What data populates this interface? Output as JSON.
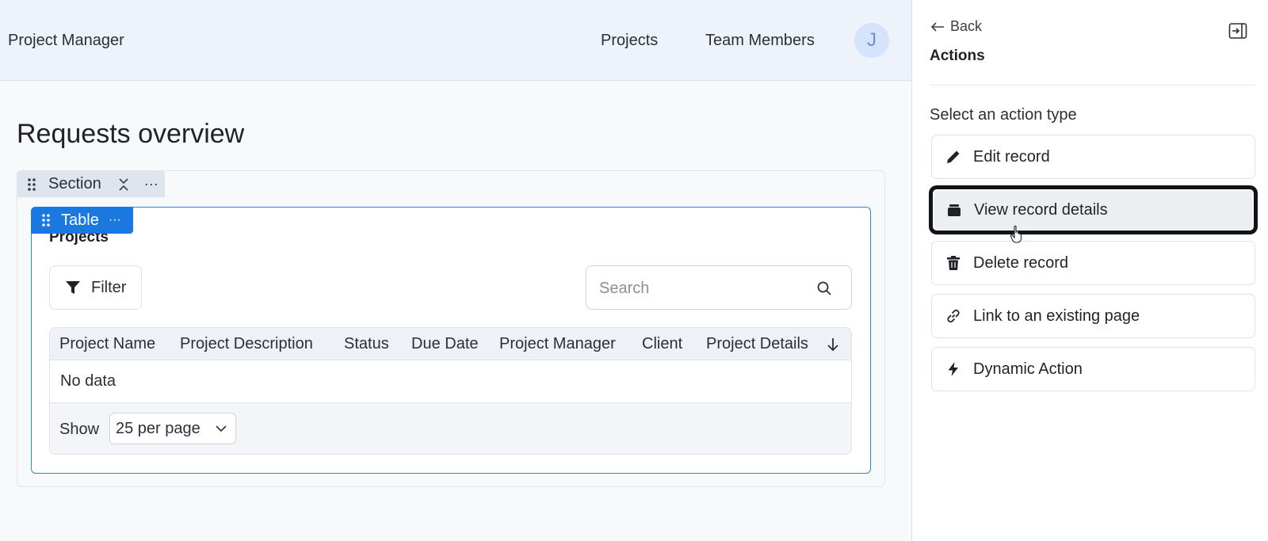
{
  "header": {
    "app_title": "Project Manager",
    "nav": [
      {
        "label": "Projects"
      },
      {
        "label": "Team Members"
      }
    ],
    "avatar_initial": "J"
  },
  "page": {
    "title": "Requests overview"
  },
  "section": {
    "tab_label": "Section",
    "grip_icon": "drag-handle-icon",
    "collapse_icon": "collapse-icon",
    "more_icon": "more-dots-icon",
    "more_glyph": "···"
  },
  "table_component": {
    "tab_label": "Table",
    "more_glyph": "···",
    "heading": "Projects",
    "filter_label": "Filter",
    "search_placeholder": "Search",
    "search_value": "",
    "columns": [
      "Project Name",
      "Project Description",
      "Status",
      "Due Date",
      "Project Manager",
      "Client",
      "Project Details"
    ],
    "empty_text": "No data",
    "show_label": "Show",
    "per_page_value": "25 per page"
  },
  "panel": {
    "back_label": "Back",
    "title": "Actions",
    "subtitle": "Select an action type",
    "actions": [
      {
        "label": "Edit record",
        "icon": "pencil-icon"
      },
      {
        "label": "View record details",
        "icon": "record-stack-icon",
        "selected": true
      },
      {
        "label": "Delete record",
        "icon": "trash-icon"
      },
      {
        "label": "Link to an existing page",
        "icon": "link-icon"
      },
      {
        "label": "Dynamic Action",
        "icon": "lightning-icon"
      }
    ]
  },
  "colors": {
    "accent": "#1a78e0",
    "header_bg": "#eef2fa",
    "selected_border": "#111418"
  }
}
